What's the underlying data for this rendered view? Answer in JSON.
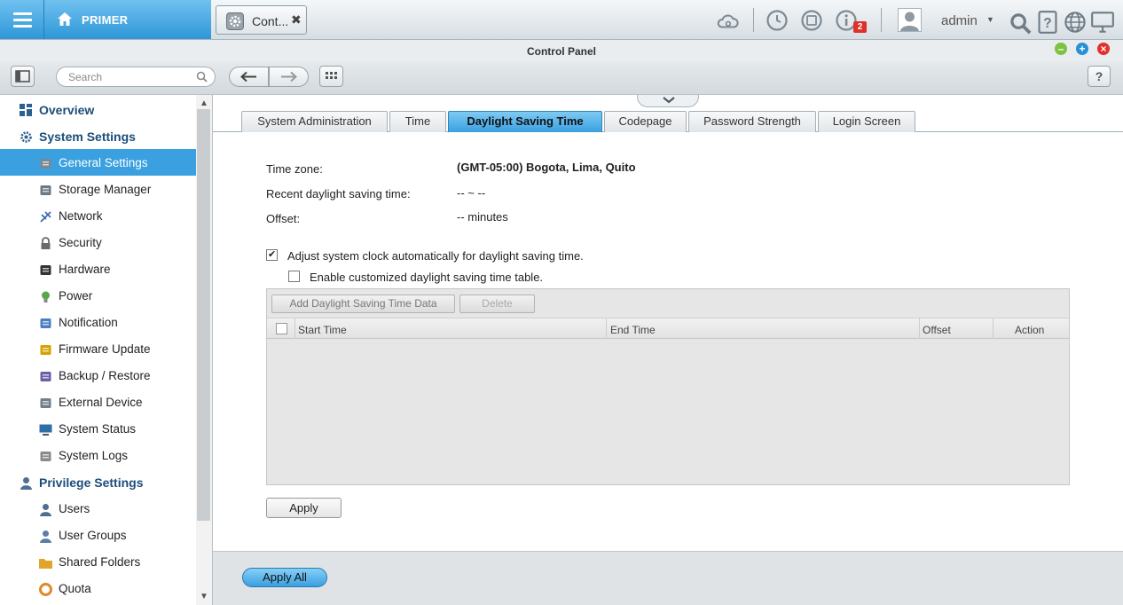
{
  "topbar": {
    "home_label": "PRIMER",
    "app_tab_label": "Cont...",
    "app_tab_close": "✖",
    "notification_count": "2",
    "user_name": "admin",
    "user_caret": "▼"
  },
  "window": {
    "title": "Control Panel"
  },
  "toolbar": {
    "search_placeholder": "Search",
    "help_label": "?"
  },
  "sidebar": {
    "items": [
      {
        "label": "Overview",
        "type": "category",
        "icon": "grid-icon"
      },
      {
        "label": "System Settings",
        "type": "category",
        "icon": "gear-icon"
      },
      {
        "label": "General Settings",
        "type": "item",
        "icon": "settings-doc-icon",
        "active": true
      },
      {
        "label": "Storage Manager",
        "type": "item",
        "icon": "storage-icon"
      },
      {
        "label": "Network",
        "type": "item",
        "icon": "network-icon"
      },
      {
        "label": "Security",
        "type": "item",
        "icon": "lock-icon"
      },
      {
        "label": "Hardware",
        "type": "item",
        "icon": "hardware-icon"
      },
      {
        "label": "Power",
        "type": "item",
        "icon": "bulb-icon"
      },
      {
        "label": "Notification",
        "type": "item",
        "icon": "notification-icon"
      },
      {
        "label": "Firmware Update",
        "type": "item",
        "icon": "firmware-icon"
      },
      {
        "label": "Backup / Restore",
        "type": "item",
        "icon": "backup-icon"
      },
      {
        "label": "External Device",
        "type": "item",
        "icon": "drive-icon"
      },
      {
        "label": "System Status",
        "type": "item",
        "icon": "monitor-icon"
      },
      {
        "label": "System Logs",
        "type": "item",
        "icon": "log-icon"
      },
      {
        "label": "Privilege Settings",
        "type": "category",
        "icon": "user-icon"
      },
      {
        "label": "Users",
        "type": "item",
        "icon": "user-icon"
      },
      {
        "label": "User Groups",
        "type": "item",
        "icon": "users-icon"
      },
      {
        "label": "Shared Folders",
        "type": "item",
        "icon": "folder-icon"
      },
      {
        "label": "Quota",
        "type": "item",
        "icon": "quota-icon"
      }
    ]
  },
  "tabs": [
    {
      "label": "System Administration"
    },
    {
      "label": "Time"
    },
    {
      "label": "Daylight Saving Time",
      "active": true
    },
    {
      "label": "Codepage"
    },
    {
      "label": "Password Strength"
    },
    {
      "label": "Login Screen"
    }
  ],
  "dst": {
    "timezone_label": "Time zone:",
    "timezone_value": "(GMT-05:00) Bogota, Lima, Quito",
    "recent_label": "Recent daylight saving time:",
    "recent_value": "-- ~ --",
    "offset_label": "Offset:",
    "offset_value": "-- minutes",
    "auto_adjust_label": "Adjust system clock automatically for daylight saving time.",
    "auto_adjust_checked": true,
    "custom_table_label": "Enable customized daylight saving time table.",
    "custom_table_checked": false,
    "add_button": "Add Daylight Saving Time Data",
    "delete_button": "Delete",
    "columns": [
      "Start Time",
      "End Time",
      "Offset",
      "Action"
    ],
    "rows": [],
    "apply_button": "Apply"
  },
  "footer": {
    "apply_all_button": "Apply All"
  },
  "colors": {
    "accent": "#3aa0e0",
    "category_text": "#1c4d7a",
    "minimize": "#7dc242",
    "maximize": "#2b8fd6",
    "close": "#e2312b",
    "badge": "#e0302a"
  }
}
